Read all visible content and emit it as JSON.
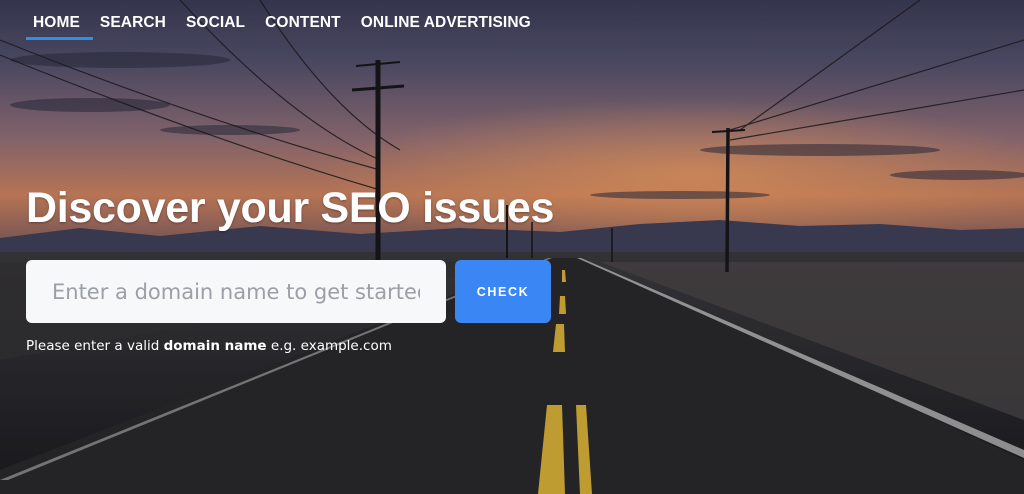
{
  "nav": {
    "items": [
      {
        "label": "HOME",
        "active": true
      },
      {
        "label": "SEARCH",
        "active": false
      },
      {
        "label": "SOCIAL",
        "active": false
      },
      {
        "label": "CONTENT",
        "active": false
      },
      {
        "label": "ONLINE ADVERTISING",
        "active": false
      }
    ],
    "active_underline_color": "#2f8fe6"
  },
  "hero": {
    "headline": "Discover your SEO issues",
    "background": "sunset desert highway with power lines"
  },
  "search": {
    "placeholder": "Enter a domain name to get started.",
    "value": "",
    "button_label": "CHECK",
    "button_color": "#3b86f5"
  },
  "hint": {
    "prefix": "Please enter a valid ",
    "emphasis": "domain name",
    "suffix": " e.g. example.com"
  }
}
